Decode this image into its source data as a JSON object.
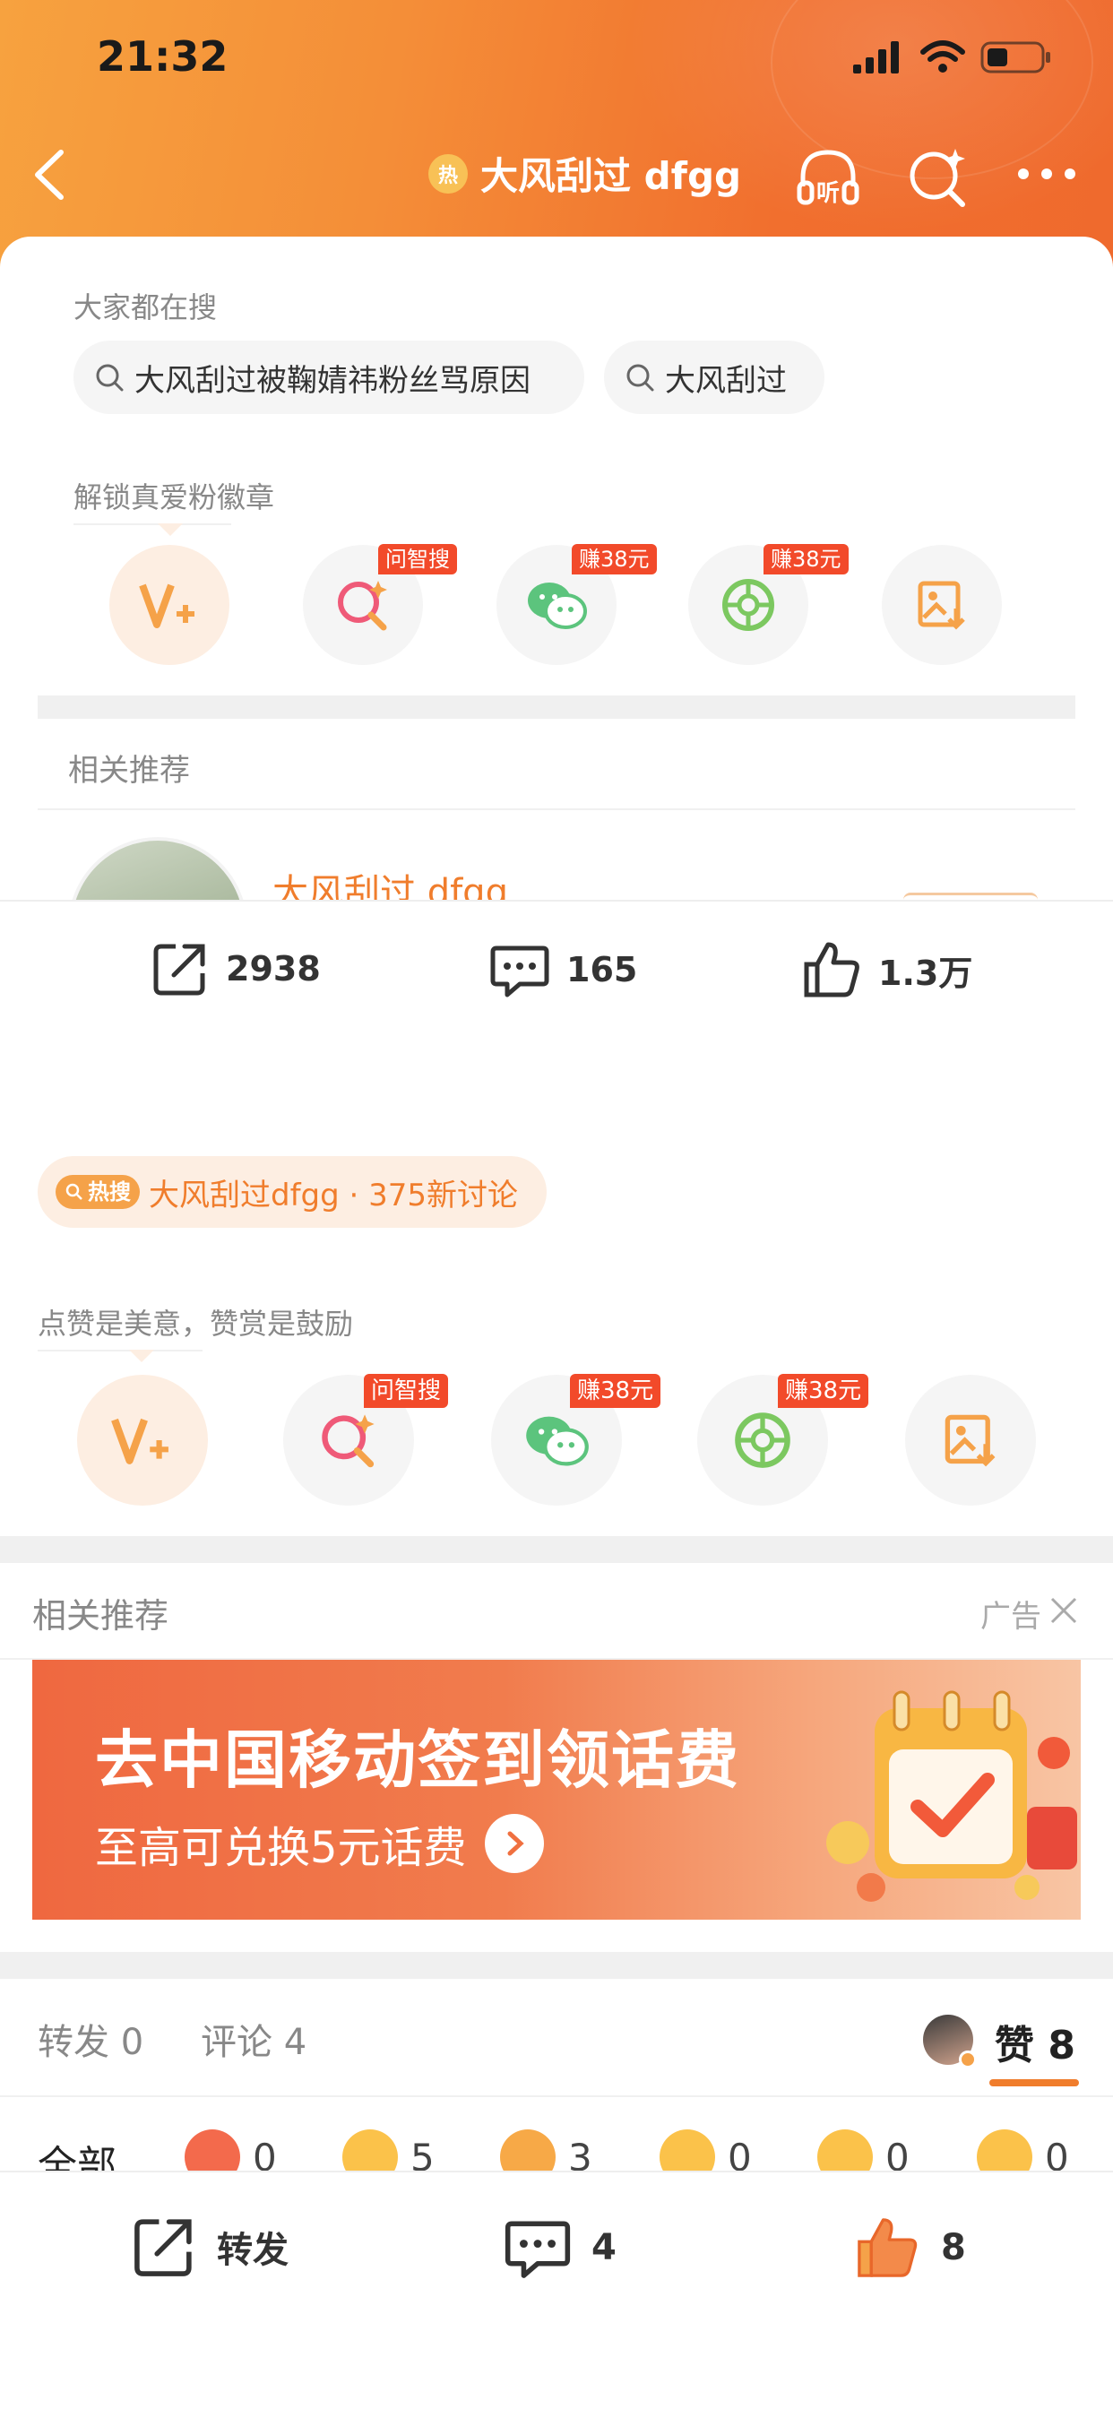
{
  "status_bar": {
    "time": "21:32"
  },
  "nav": {
    "hot_badge": "热",
    "title": "大风刮过 dfgg",
    "listen_label": "听"
  },
  "search_section": {
    "label": "大家都在搜",
    "pills": [
      "大风刮过被鞠婧祎粉丝骂原因",
      "大风刮过"
    ]
  },
  "unlock_section": {
    "label": "解锁真爱粉徽章",
    "actions": [
      {
        "icon": "v-plus-icon",
        "tag": ""
      },
      {
        "icon": "ai-search-icon",
        "tag": "问智搜"
      },
      {
        "icon": "wechat-icon",
        "tag": "赚38元"
      },
      {
        "icon": "moments-icon",
        "tag": "赚38元"
      },
      {
        "icon": "save-image-icon",
        "tag": ""
      }
    ]
  },
  "related_top": {
    "label": "相关推荐",
    "user_name": "大风刮过 dfgg"
  },
  "stats": {
    "repost": "2938",
    "comment": "165",
    "like": "1.3万"
  },
  "hot_chip": {
    "tag": "热搜",
    "text": "大风刮过dfgg · 375新讨论"
  },
  "reward_section": {
    "label": "点赞是美意，赞赏是鼓励",
    "actions": [
      {
        "icon": "v-plus-icon",
        "tag": ""
      },
      {
        "icon": "ai-search-icon",
        "tag": "问智搜"
      },
      {
        "icon": "wechat-icon",
        "tag": "赚38元"
      },
      {
        "icon": "moments-icon",
        "tag": "赚38元"
      },
      {
        "icon": "save-image-icon",
        "tag": ""
      }
    ]
  },
  "related_ad": {
    "label": "相关推荐",
    "ad_label": "广告",
    "banner_title": "去中国移动签到领话费",
    "banner_sub": "至高可兑换5元话费"
  },
  "tabs": {
    "repost": "转发 0",
    "comment": "评论 4",
    "like": "赞 8"
  },
  "reactions": {
    "all_label": "全部",
    "items": [
      {
        "icon": "reward-icon",
        "count": "0",
        "color": "#f36a4c"
      },
      {
        "icon": "heart-face-icon",
        "count": "5",
        "color": "#fbc24a"
      },
      {
        "icon": "thumbs-up-face-icon",
        "count": "3",
        "color": "#f7a947"
      },
      {
        "icon": "laugh-icon",
        "count": "0",
        "color": "#fbc24a"
      },
      {
        "icon": "surprised-icon",
        "count": "0",
        "color": "#fbc24a"
      },
      {
        "icon": "cry-icon",
        "count": "0",
        "color": "#fbc24a"
      }
    ]
  },
  "bottom_bar": {
    "repost": "转发",
    "comment": "4",
    "like": "8"
  },
  "colors": {
    "accent": "#f07d2c",
    "tag_red": "#f24a2a",
    "header_start": "#f7a23f",
    "header_end": "#ef6a2d"
  }
}
